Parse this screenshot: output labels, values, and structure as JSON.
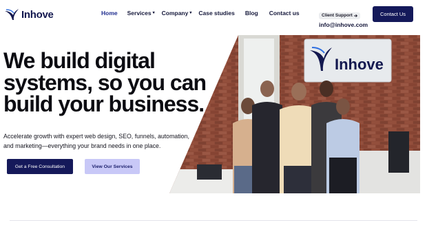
{
  "brand": {
    "name": "Inhove",
    "color": "#13184f",
    "accent": "#2f6fe0"
  },
  "nav": {
    "items": [
      {
        "label": "Home",
        "active": true,
        "dropdown": false
      },
      {
        "label": "Services",
        "active": false,
        "dropdown": true
      },
      {
        "label": "Company",
        "active": false,
        "dropdown": true
      },
      {
        "label": "Case studies",
        "active": false,
        "dropdown": false
      },
      {
        "label": "Blog",
        "active": false,
        "dropdown": false
      },
      {
        "label": "Contact us",
        "active": false,
        "dropdown": false
      }
    ]
  },
  "support": {
    "badge": "Client Support",
    "email": "info@inhove.com",
    "arrow_icon": "arrow-right-icon"
  },
  "header": {
    "contact_button": "Contact Us"
  },
  "hero": {
    "title_lines": [
      "We build digital",
      "systems, so you can",
      "build your business."
    ],
    "subtitle_lines": [
      "Accelerate growth with expert web design, SEO, funnels, automation,",
      "and marketing—everything your brand needs in one place."
    ],
    "primary_button": "Get a Free Consultation",
    "secondary_button": "View Our Services"
  },
  "photo": {
    "wall_sign": "Inhove"
  },
  "colors": {
    "primary": "#15195a",
    "secondary_bg": "#c8c8f7",
    "brick": "#8c4a38"
  }
}
